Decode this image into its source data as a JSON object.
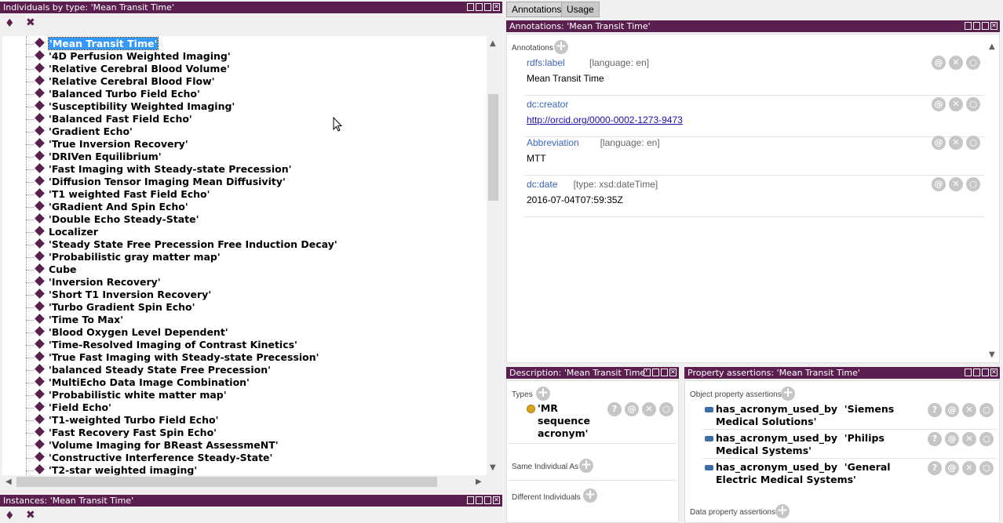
{
  "left_panel": {
    "title": "Individuals by type: 'Mean Transit Time'",
    "selected": "'Mean Transit Time'",
    "items": [
      "'4D Perfusion Weighted Imaging'",
      "'Relative Cerebral Blood Volume'",
      "'Relative Cerebral Blood Flow'",
      "'Balanced Turbo Field Echo'",
      "'Susceptibility Weighted Imaging'",
      "'Balanced Fast Field Echo'",
      "'Gradient Echo'",
      "'True Inversion Recovery'",
      "'DRIVen Equilibrium'",
      "'Fast Imaging with Steady-state Precession'",
      "'Diffusion Tensor Imaging Mean Diffusivity'",
      "'T1 weighted Fast Field Echo'",
      "'GRadient And Spin Echo'",
      "'Double Echo Steady-State'",
      "Localizer",
      "'Steady State Free Precession Free Induction Decay'",
      "'Probabilistic gray matter map'",
      "Cube",
      "'Inversion Recovery'",
      "'Short T1 Inversion Recovery'",
      "'Turbo Gradient Spin Echo'",
      "'Time To Max'",
      "'Blood Oxygen Level Dependent'",
      "'Time-Resolved Imaging of Contrast Kinetics'",
      "'True Fast Imaging with Steady-state Precession'",
      "'balanced Steady State Free Precession'",
      "'MultiEcho Data Image Combination'",
      "'Probabilistic white matter map'",
      "'Field Echo'",
      "'T1-weighted Turbo Field Echo'",
      "'Fast Recovery Fast Spin Echo'",
      "'Volume Imaging for BReast AssessmeNT'",
      "'Constructive Interference Steady-State'",
      "'T2-star weighted imaging'"
    ]
  },
  "instances_panel": {
    "title": "Instances: 'Mean Transit Time'"
  },
  "tabs": {
    "annotations": "Annotations",
    "usage": "Usage"
  },
  "annotations_panel": {
    "title": "Annotations: 'Mean Transit Time'",
    "section_label": "Annotations",
    "rows": [
      {
        "prop": "rdfs:label",
        "meta": "[language: en]",
        "value": "Mean Transit Time"
      },
      {
        "prop": "dc:creator",
        "meta": "",
        "value": "http://orcid.org/0000-0002-1273-9473"
      },
      {
        "prop": "Abbreviation",
        "meta": "[language: en]",
        "value": "MTT"
      },
      {
        "prop": "dc:date",
        "meta": "[type: xsd:dateTime]",
        "value": "2016-07-04T07:59:35Z"
      }
    ]
  },
  "description_panel": {
    "title": "Description: 'Mean Transit Time'",
    "types_label": "Types",
    "type_line1": "'MR",
    "type_line2": "sequence",
    "type_line3": "acronym'",
    "same_label": "Same Individual As",
    "different_label": "Different Individuals"
  },
  "property_panel": {
    "title": "Property assertions: 'Mean Transit Time'",
    "object_label": "Object property assertions",
    "data_label": "Data property assertions",
    "assertions": [
      {
        "line1": "has_acronym_used_by  'Siemens",
        "line2": "Medical Solutions'"
      },
      {
        "line1": "has_acronym_used_by  'Philips",
        "line2": "Medical Systems'"
      },
      {
        "line1": "has_acronym_used_by  'General",
        "line2": "Electric Medical Systems'"
      }
    ]
  },
  "buttons": {
    "plus": "+",
    "at": "@",
    "x": "✕",
    "o": "○",
    "q": "?"
  }
}
